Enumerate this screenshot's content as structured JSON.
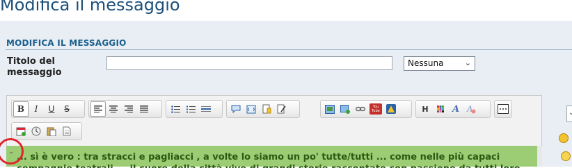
{
  "page": {
    "title": "Modifica il messaggio"
  },
  "form": {
    "section_header": "MODIFICA IL MESSAGGIO",
    "title_label": "Titolo del messaggio",
    "title_value": "",
    "prefix_value": "Nessuna"
  },
  "toolbar": {
    "groups": [
      [
        "bold",
        "italic",
        "underline",
        "strikethrough"
      ],
      [
        "align-left",
        "align-center",
        "align-right",
        "justify"
      ],
      [
        "unordered-list",
        "ordered-list",
        "horizontal-rule"
      ],
      [
        "quote",
        "code",
        "spoiler",
        "edit"
      ],
      [
        "insert-image",
        "insert-image-upload",
        "insert-link",
        "youtube",
        "warning"
      ],
      [
        "heading",
        "color",
        "font",
        "remove-format"
      ],
      [
        "more"
      ],
      [
        "calendar",
        "clock",
        "paste",
        "paste-text"
      ]
    ],
    "bold_label": "B",
    "italic_label": "I",
    "underline_label": "U",
    "strike_label": "S",
    "heading_label": "H",
    "font_label": "A",
    "youtube_label": "You Tube"
  },
  "editor": {
    "line1": "... sì è vero : tra stracci e pagliacci , a volte lo siamo un po' tutte/tutti ... come nelle più capaci",
    "line2": "compagnie teatrali ... il cuore della città vive di grandi storie raccontate con passione da tutti loro",
    "content_bg": "#9ccc73"
  },
  "colors": {
    "title": "#1a4f7a",
    "section_header": "#1a5f8e",
    "annotation": "#e0252a"
  }
}
